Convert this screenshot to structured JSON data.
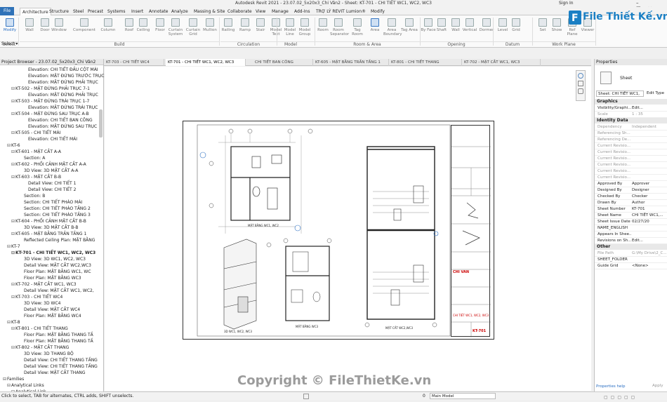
{
  "app": {
    "title": "Autodesk Revit 2021 - 23.07.02_5x20x3_Chi Vân2 - Sheet: KT-701 - CHI TIẾT WC1, WC2, WC3",
    "signin": "Sign In"
  },
  "menu_tabs": [
    "File",
    "Architecture",
    "Structure",
    "Steel",
    "Precast",
    "Systems",
    "Insert",
    "Annotate",
    "Analyze",
    "Massing & Site",
    "Collaborate",
    "View",
    "Manage",
    "Add-Ins",
    "TRỢ LÝ REVIT",
    "Lumion®",
    "Modify"
  ],
  "ribbon": {
    "buttons": [
      "Modify",
      "Wall",
      "Door",
      "Window",
      "Component",
      "Column",
      "Roof",
      "Ceiling",
      "Floor",
      "Curtain System",
      "Curtain Grid",
      "Mullion",
      "Railing",
      "Ramp",
      "Stair",
      "Model Text",
      "Model Line",
      "Model Group",
      "Room",
      "Room Separator",
      "Tag Room",
      "Area",
      "Area Boundary",
      "Tag Area",
      "By Face",
      "Shaft",
      "Wall",
      "Vertical",
      "Dormer",
      "Level",
      "Grid",
      "Set",
      "Show",
      "Ref Plane",
      "Viewer"
    ],
    "groups": [
      "Select",
      "Build",
      "Circulation",
      "Model",
      "Room & Area",
      "Opening",
      "Datum",
      "Work Plane"
    ]
  },
  "logo": {
    "text": "File Thiết Kế.vn"
  },
  "project_browser": {
    "title": "Project Browser - 23.07.02_5x20x3_Chi Vân2",
    "items": [
      "Elevation: CHI TIẾT ĐẦU CỘT MÁI",
      "Elevation: MẶT ĐỨNG TRƯỚC TRỤC",
      "Elevation: MẶT ĐỨNG PHẢI TRỤC",
      "KT-502 - MẶT ĐỨNG PHẢI TRỤC 7-1",
      "Elevation: MẶT ĐỨNG PHẢI TRỤC",
      "KT-503 - MẶT ĐỨNG TRÁI TRỤC 1-7",
      "Elevation: MẶT ĐỨNG TRÁI TRỤC",
      "KT-504 - MẶT ĐỨNG SAU TRỤC A-B",
      "Elevation: CHI TIẾT BAN CÔNG",
      "Elevation: MẶT ĐỨNG SAU TRỤC",
      "KT-505 - CHI TIẾT MÁI",
      "Elevation: CHI TIẾT MÁI",
      "KT-6",
      "KT-601 - MẶT CẮT A-A",
      "Section: A",
      "KT-602 - PHỐI CẢNH MẶT CẮT A-A",
      "3D View: 3D MẶT CẮT A-A",
      "KT-603 - MẶT CẮT B-B",
      "Detail View: CHI TIẾT 1",
      "Detail View: CHI TIẾT 2",
      "Section: B",
      "Section: CHI TIẾT PHÀO MÁI",
      "Section: CHI TIẾT PHÀO TẦNG 2",
      "Section: CHI TIẾT PHÀO TẦNG 3",
      "KT-604 - PHỐI CẢNH MẶT CẮT B-B",
      "3D View: 3D MẶT CẮT B-B",
      "KT-605 - MẶT BẰNG TRẦN TẦNG 1",
      "Reflected Ceiling Plan: MẶT BẰNG",
      "KT-7",
      "KT-701 - CHI TIẾT WC1, WC2, WC3",
      "3D View: 3D WC1, WC2, WC3",
      "Detail View: MẶT CẮT WC2,WC3",
      "Floor Plan: MẶT BẰNG WC1, WC",
      "Floor Plan: MẶT BẰNG WC3",
      "KT-702 - MẶT CẮT WC1, WC3",
      "Detail View: MẶT CẮT WC1, WC2,",
      "KT-703 - CHI TIẾT WC4",
      "3D View: 3D WC4",
      "Detail View: MẶT CẮT WC4",
      "Floor Plan: MẶT BẰNG WC4",
      "KT-8",
      "KT-801 - CHI TIẾT THANG",
      "Floor Plan: MẶT BẰNG THANG TẦ",
      "Floor Plan: MẶT BẰNG THANG TẦ",
      "KT-802 - MẶT CẮT THANG",
      "3D View: 3D THANG BỘ",
      "Detail View: CHI TIẾT THANG TẦNG",
      "Detail View: CHI TIẾT THANG TẦNG",
      "Detail View: MẶT CẮT THANG",
      "Families",
      "Analytical Links",
      "Analytical Link"
    ]
  },
  "view_tabs": [
    "KT-703 - CHI TIẾT WC4",
    "KT-701 - CHI TIẾT WC1, WC2, WC3",
    "CHI TIẾT BAN CÔNG",
    "KT-605 - MẶT BẰNG TRẦN TẦNG 1",
    "KT-801 - CHI TIẾT THANG",
    "KT-702 - MẶT CẮT WC1, WC3"
  ],
  "drawing": {
    "l1": "MẶT BẰNG WC1, WC2",
    "l2": "3D WC1, WC2, WC3",
    "l3": "MẶT BẰNG WC3",
    "l4": "MẶT CẮT WC2,WC3",
    "tb1": "CHI VÂN",
    "tb2": "CHI TIẾT WC1, WC2, WC3",
    "tb3": "KT-701"
  },
  "properties": {
    "title": "Properties",
    "type": "Sheet",
    "selector": "Sheet: CHI TIẾT WC1,",
    "edit_type": "Edit Type",
    "sections": [
      "Graphics",
      "Identity Data",
      "Other"
    ],
    "graphics": [
      [
        "Visibility/Graphi...",
        "Edit..."
      ],
      [
        "Scale",
        "1 : 35"
      ]
    ],
    "identity": [
      [
        "Dependency",
        "Independent"
      ],
      [
        "Referencing Sh...",
        ""
      ],
      [
        "Referencing De...",
        ""
      ],
      [
        "Current Revisio...",
        ""
      ],
      [
        "Current Revisio...",
        ""
      ],
      [
        "Current Revisio...",
        ""
      ],
      [
        "Current Revisio...",
        ""
      ],
      [
        "Current Revisio...",
        ""
      ],
      [
        "Current Revisio...",
        ""
      ],
      [
        "Approved By",
        "Approver"
      ],
      [
        "Designed By",
        "Designer"
      ],
      [
        "Checked By",
        "Checker"
      ],
      [
        "Drawn By",
        "Author"
      ],
      [
        "Sheet Number",
        "KT-701"
      ],
      [
        "Sheet Name",
        "CHI TIẾT WC1,..."
      ],
      [
        "Sheet Issue Date",
        "02/27/20"
      ],
      [
        "NAME_ENGLISH",
        ""
      ],
      [
        "Appears In Shee...",
        ""
      ],
      [
        "Revisions on Sh...",
        "Edit..."
      ]
    ],
    "other": [
      [
        "File Path",
        "G:\\My Drive\\2_C..."
      ],
      [
        "SHEET_FOLDER",
        ""
      ],
      [
        "Guide Grid",
        "<None>"
      ]
    ],
    "help": "Properties help",
    "apply": "Apply"
  },
  "status": {
    "text": "Click to select, TAB for alternates, CTRL adds, SHIFT unselects.",
    "model": "Main Model",
    "scale_val": "0"
  },
  "watermark": "Copyright © FileThietKe.vn"
}
